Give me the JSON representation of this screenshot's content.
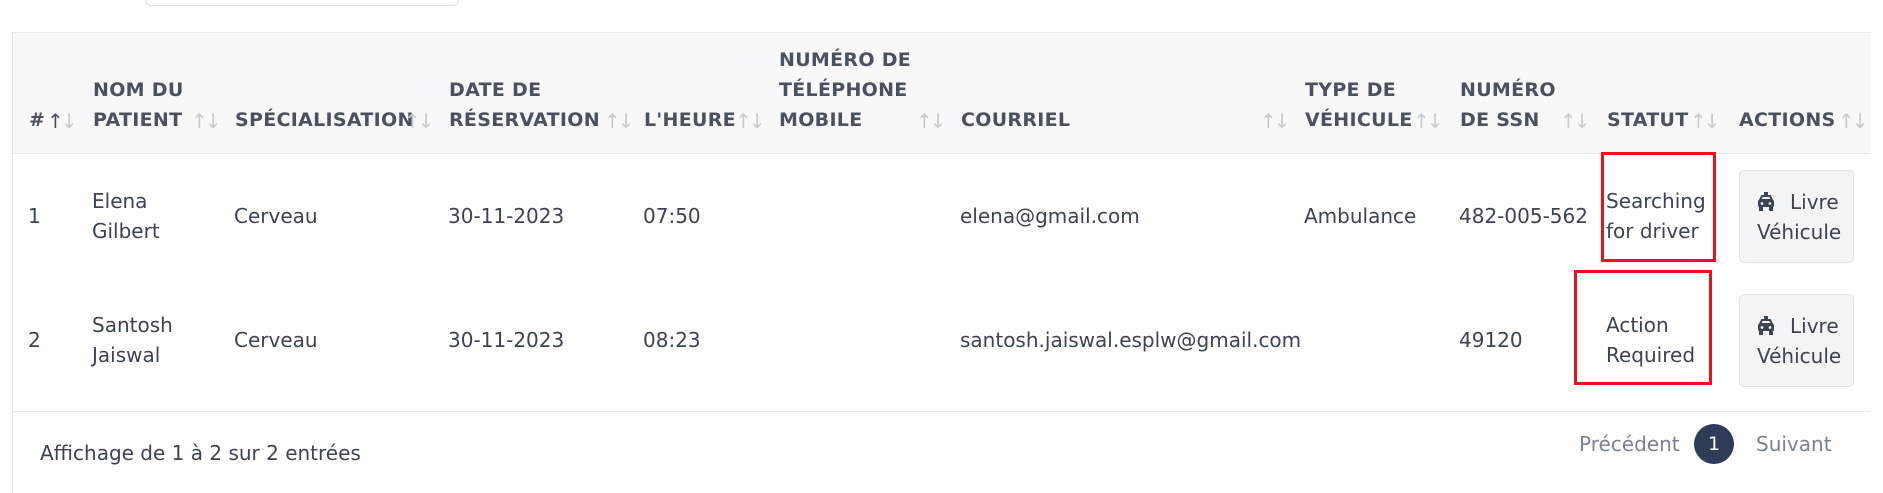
{
  "table": {
    "columns": [
      {
        "key": "num",
        "label": "#"
      },
      {
        "key": "patient",
        "label": "NOM DU PATIENT"
      },
      {
        "key": "specialisation",
        "label": "SPÉCIALISATION"
      },
      {
        "key": "date",
        "label": "DATE DE RÉSERVATION"
      },
      {
        "key": "heure",
        "label": "L'HEURE"
      },
      {
        "key": "telephone",
        "label": "NUMÉRO DE TÉLÉPHONE MOBILE"
      },
      {
        "key": "courriel",
        "label": "COURRIEL"
      },
      {
        "key": "vehicule",
        "label": "TYPE DE VÉHICULE"
      },
      {
        "key": "ssn",
        "label": "NUMÉRO DE SSN"
      },
      {
        "key": "statut",
        "label": "STATUT"
      },
      {
        "key": "actions",
        "label": "ACTIONS"
      }
    ],
    "rows": [
      {
        "num": "1",
        "patient": "Elena Gilbert",
        "specialisation": "Cerveau",
        "date": "30-11-2023",
        "heure": "07:50",
        "telephone": "",
        "courriel": "elena@gmail.com",
        "vehicule": "Ambulance",
        "ssn": "482-005-562",
        "statut": "Searching for driver",
        "action_label": "Livre Véhicule"
      },
      {
        "num": "2",
        "patient": "Santosh Jaiswal",
        "specialisation": "Cerveau",
        "date": "30-11-2023",
        "heure": "08:23",
        "telephone": "",
        "courriel": "santosh.jaiswal.esplw@gmail.com",
        "vehicule": "",
        "ssn": "49120",
        "statut": "Action Required",
        "action_label": "Livre Véhicule"
      }
    ]
  },
  "pagination": {
    "info": "Affichage de 1 à 2 sur 2 entrées",
    "previous": "Précédent",
    "current": "1",
    "next": "Suivant"
  },
  "colors": {
    "header_bg": "#f7f8fa",
    "highlight_border": "#e8141b",
    "page_active": "#2f3b57"
  }
}
